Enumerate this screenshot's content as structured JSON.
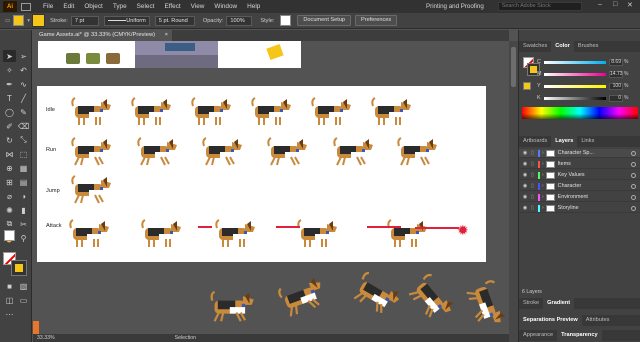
{
  "app": {
    "logo": "Ai",
    "menu": [
      "File",
      "Edit",
      "Object",
      "Type",
      "Select",
      "Effect",
      "View",
      "Window",
      "Help"
    ],
    "workspace": "Printing and Proofing",
    "search_placeholder": "Search Adobe Stock"
  },
  "control_bar": {
    "stroke_label": "Stroke:",
    "stroke_value": "7 pt",
    "profile": "Uniform",
    "brush": "5 pt. Round",
    "opacity_label": "Opacity:",
    "opacity_value": "100%",
    "style_label": "Style:",
    "doc_setup": "Document Setup",
    "preferences": "Preferences"
  },
  "document": {
    "tab_title": "Game Assets.ai* @ 33.33% (CMYK/Preview)",
    "close": "×",
    "row_labels": [
      "Idle",
      "Run",
      "Jump",
      "Attack"
    ]
  },
  "status": {
    "zoom": "33.33%",
    "tool": "Selection"
  },
  "color_panel": {
    "tabs": [
      "Swatches",
      "Color",
      "Brushes"
    ],
    "active_tab": "Color",
    "channels": [
      {
        "name": "C",
        "value": "8.69"
      },
      {
        "name": "M",
        "value": "14.73"
      },
      {
        "name": "Y",
        "value": "100"
      },
      {
        "name": "K",
        "value": "0"
      }
    ],
    "percent": "%",
    "fill_color": "#f5c518"
  },
  "layers_panel": {
    "tabs": [
      "Artboards",
      "Layers",
      "Links"
    ],
    "active_tab": "Layers",
    "layers": [
      {
        "name": "Character Sp...",
        "color": "#4f7fff",
        "selected": true
      },
      {
        "name": "Items",
        "color": "#ff4f4f",
        "selected": false
      },
      {
        "name": "Key Values",
        "color": "#4fff4f",
        "selected": false
      },
      {
        "name": "Character",
        "color": "#4f4fff",
        "selected": false
      },
      {
        "name": "Environment",
        "color": "#ff4fff",
        "selected": false
      },
      {
        "name": "Storyline",
        "color": "#4fffff",
        "selected": false
      }
    ],
    "count": "6 Layers"
  },
  "bottom_panels": {
    "stroke_tabs": [
      "Stroke",
      "Gradient"
    ],
    "sep_tabs": [
      "Separations Preview",
      "Attributes"
    ],
    "app_tabs": [
      "Appearance",
      "Transparency"
    ]
  }
}
